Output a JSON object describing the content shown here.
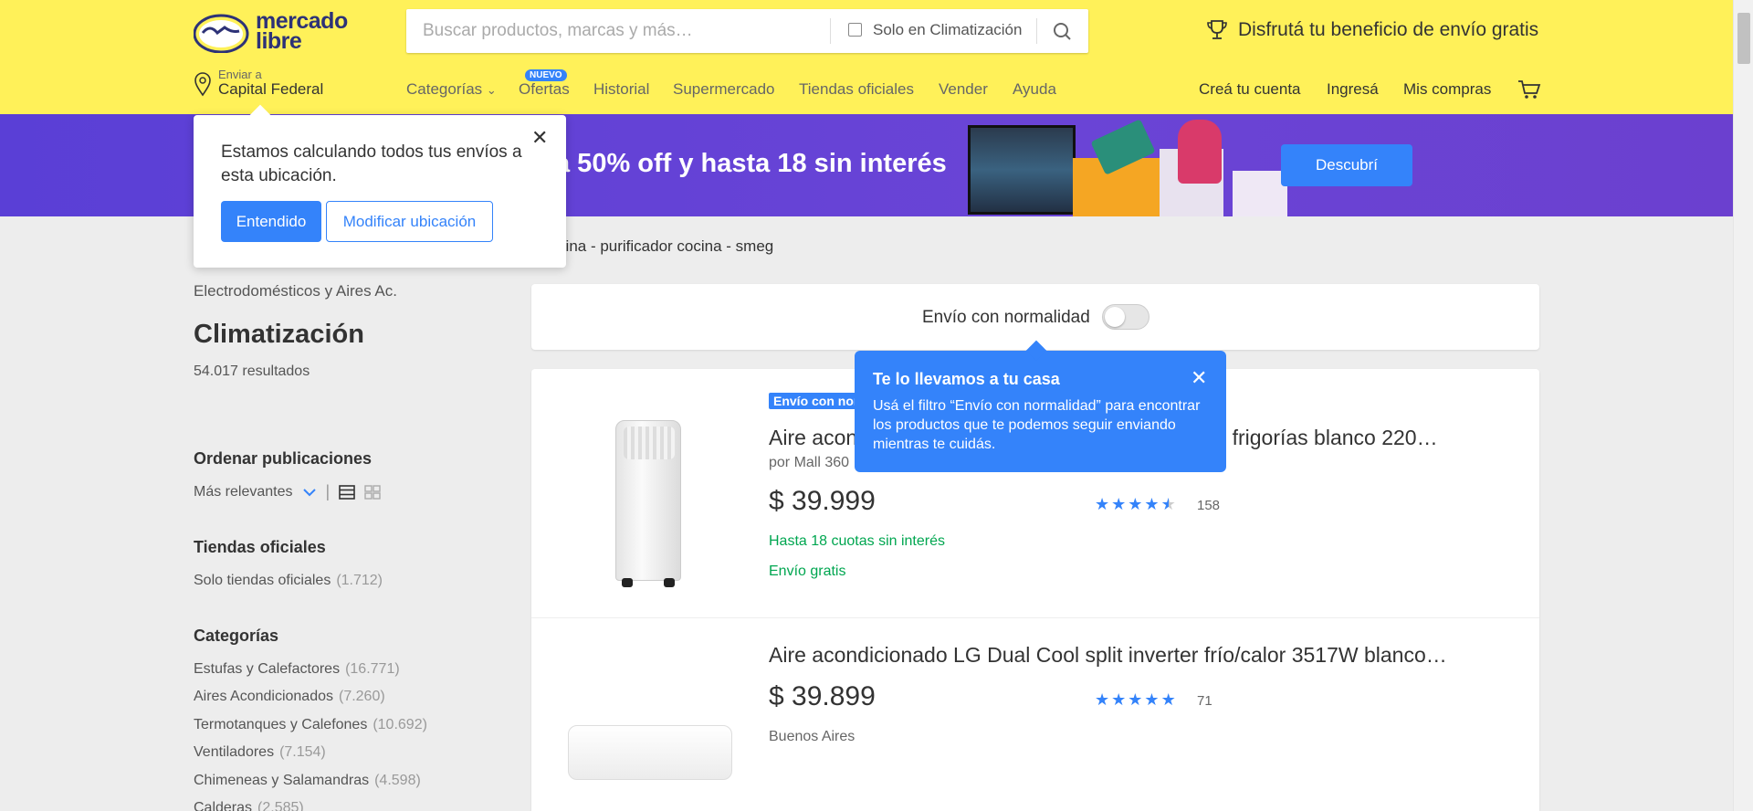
{
  "header": {
    "logo_text": "mercado\nlibre",
    "search_placeholder": "Buscar productos, marcas y más…",
    "search_filter_label": "Solo en Climatización",
    "benefit_text": "Disfrutá tu beneficio de envío gratis",
    "location_small": "Enviar a",
    "location_city": "Capital Federal",
    "nav": [
      "Categorías",
      "Ofertas",
      "Historial",
      "Supermercado",
      "Tiendas oficiales",
      "Vender",
      "Ayuda"
    ],
    "nuevo_badge": "NUEVO",
    "right_nav": [
      "Creá tu cuenta",
      "Ingresá",
      "Mis compras"
    ]
  },
  "banner": {
    "text": "a 50% off y hasta 18 sin interés",
    "button": "Descubrí"
  },
  "location_popup": {
    "message": "Estamos calculando todos tus envíos a esta ubicación.",
    "primary": "Entendido",
    "secondary": "Modificar ubicación"
  },
  "related_searches": "ana cocina - purificador cocina - smeg",
  "sidebar": {
    "breadcrumb": "Electrodomésticos y Aires Ac.",
    "title": "Climatización",
    "results": "54.017 resultados",
    "sort_heading": "Ordenar publicaciones",
    "sort_value": "Más relevantes",
    "official_heading": "Tiendas oficiales",
    "official_item": {
      "label": "Solo tiendas oficiales",
      "count": "(1.712)"
    },
    "categories_heading": "Categorías",
    "categories": [
      {
        "label": "Estufas y Calefactores",
        "count": "(16.771)"
      },
      {
        "label": "Aires Acondicionados",
        "count": "(7.260)"
      },
      {
        "label": "Termotanques y Calefones",
        "count": "(10.692)"
      },
      {
        "label": "Ventiladores",
        "count": "(7.154)"
      },
      {
        "label": "Chimeneas y Salamandras",
        "count": "(4.598)"
      },
      {
        "label": "Calderas",
        "count": "(2.585)"
      }
    ]
  },
  "filter": {
    "label": "Envío con normalidad",
    "enabled": false
  },
  "tooltip": {
    "title": "Te lo llevamos a tu casa",
    "body": "Usá el filtro “Envío con normalidad” para encontrar los productos que te podemos seguir enviando mientras te cuidás."
  },
  "products": [
    {
      "badge": "Envío con normalidad",
      "title": "Aire acondicionado Sansei portátil frío/calor 3000 frigorías blanco 220…",
      "seller": "por Mall 360",
      "price": "$ 39.999",
      "installments": "Hasta 18 cuotas sin interés",
      "shipping": "Envío gratis",
      "rating": 4.5,
      "reviews": "158"
    },
    {
      "title": "Aire acondicionado LG Dual Cool split inverter frío/calor 3517W blanco…",
      "price": "$ 39.899",
      "location": "Buenos Aires",
      "rating": 5,
      "reviews": "71"
    }
  ],
  "colors": {
    "header_bg": "#fff159",
    "accent": "#3483fa",
    "banner_bg": "#5a3fd6",
    "green": "#00a650"
  }
}
